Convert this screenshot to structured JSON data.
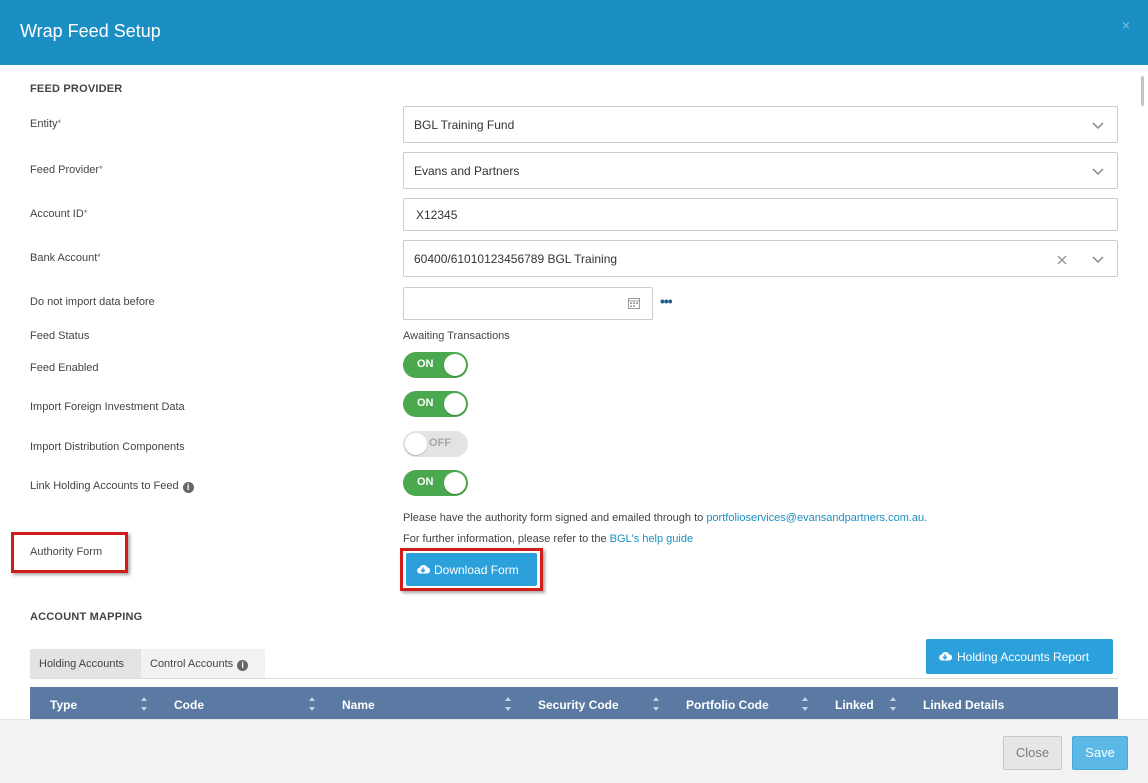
{
  "dialog": {
    "title": "Wrap Feed Setup",
    "close_glyph": "×"
  },
  "feed_provider": {
    "section_title": "FEED PROVIDER",
    "entity": {
      "label": "Entity",
      "value": "BGL Training Fund"
    },
    "feed_provider": {
      "label": "Feed Provider",
      "value": "Evans and Partners"
    },
    "account_id": {
      "label": "Account ID",
      "value": "X12345"
    },
    "bank_account": {
      "label": "Bank Account",
      "value": "60400/61010123456789 BGL Training"
    },
    "do_not_import": {
      "label": "Do not import data before",
      "value": ""
    },
    "feed_status": {
      "label": "Feed Status",
      "value": "Awaiting Transactions"
    },
    "feed_enabled": {
      "label": "Feed Enabled",
      "state": "ON"
    },
    "import_foreign": {
      "label": "Import Foreign Investment Data",
      "state": "ON"
    },
    "import_distribution": {
      "label": "Import Distribution Components",
      "state": "OFF"
    },
    "link_holding": {
      "label": "Link Holding Accounts to Feed",
      "state": "ON"
    },
    "required_mark": "*",
    "more_glyph": "•••"
  },
  "authority": {
    "label": "Authority Form",
    "line1_prefix": "Please have the authority form signed and emailed through to ",
    "email": "portfolioservices@evansandpartners.com.au",
    "line1_suffix": ".",
    "line2_prefix": "For further information, please refer to the ",
    "help_link": "BGL's help guide",
    "download_button": "Download Form"
  },
  "account_mapping": {
    "section_title": "ACCOUNT MAPPING",
    "tabs": [
      "Holding Accounts",
      "Control Accounts"
    ],
    "report_button": "Holding Accounts Report",
    "columns": [
      "Type",
      "Code",
      "Name",
      "Security Code",
      "Portfolio Code",
      "Linked",
      "Linked Details"
    ]
  },
  "footer": {
    "close": "Close",
    "save": "Save"
  },
  "colors": {
    "header": "#1b8fc3",
    "toggle_on": "#4aa84e",
    "table_header": "#5b7aa3",
    "highlight": "#d21b1b",
    "primary_button": "#2ca0db"
  },
  "icons": [
    "close-icon",
    "chevron-down-icon",
    "clear-icon",
    "calendar-icon",
    "more-icon",
    "info-icon",
    "cloud-download-icon",
    "sort-icon"
  ]
}
